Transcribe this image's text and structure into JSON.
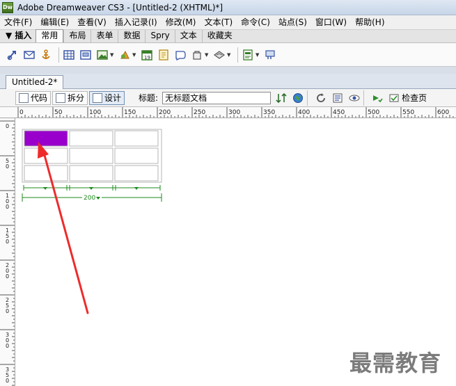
{
  "window": {
    "title": "Adobe Dreamweaver CS3 - [Untitled-2 (XHTML)*]",
    "app_icon_text": "Dw"
  },
  "menubar": {
    "items": [
      "文件(F)",
      "编辑(E)",
      "查看(V)",
      "插入记录(I)",
      "修改(M)",
      "文本(T)",
      "命令(C)",
      "站点(S)",
      "窗口(W)",
      "帮助(H)"
    ]
  },
  "insertbar": {
    "label": "▼ 插入",
    "tabs": [
      "常用",
      "布局",
      "表单",
      "数据",
      "Spry",
      "文本",
      "收藏夹"
    ],
    "active_tab": "常用"
  },
  "document": {
    "tab": "Untitled-2*",
    "views": [
      {
        "label": "代码",
        "active": false
      },
      {
        "label": "拆分",
        "active": false
      },
      {
        "label": "设计",
        "active": true
      }
    ],
    "title_label": "标题:",
    "title_value": "无标题文档",
    "check_page_label": "检查页"
  },
  "ruler": {
    "h_labels": [
      "0",
      "50",
      "100",
      "150",
      "200",
      "250",
      "300",
      "350",
      "400",
      "450",
      "500",
      "550",
      "600"
    ],
    "v_labels": [
      "0",
      "50",
      "100",
      "150",
      "200",
      "250",
      "300",
      "350"
    ]
  },
  "table": {
    "rows": 3,
    "cols": 3,
    "selected_cell": [
      0,
      0
    ],
    "width_label": "200"
  },
  "colors": {
    "selected_cell": "#9900cc",
    "guide": "#1b8a1b",
    "arrow": "#ee2b2b"
  },
  "watermark": {
    "text": "最需教育"
  }
}
